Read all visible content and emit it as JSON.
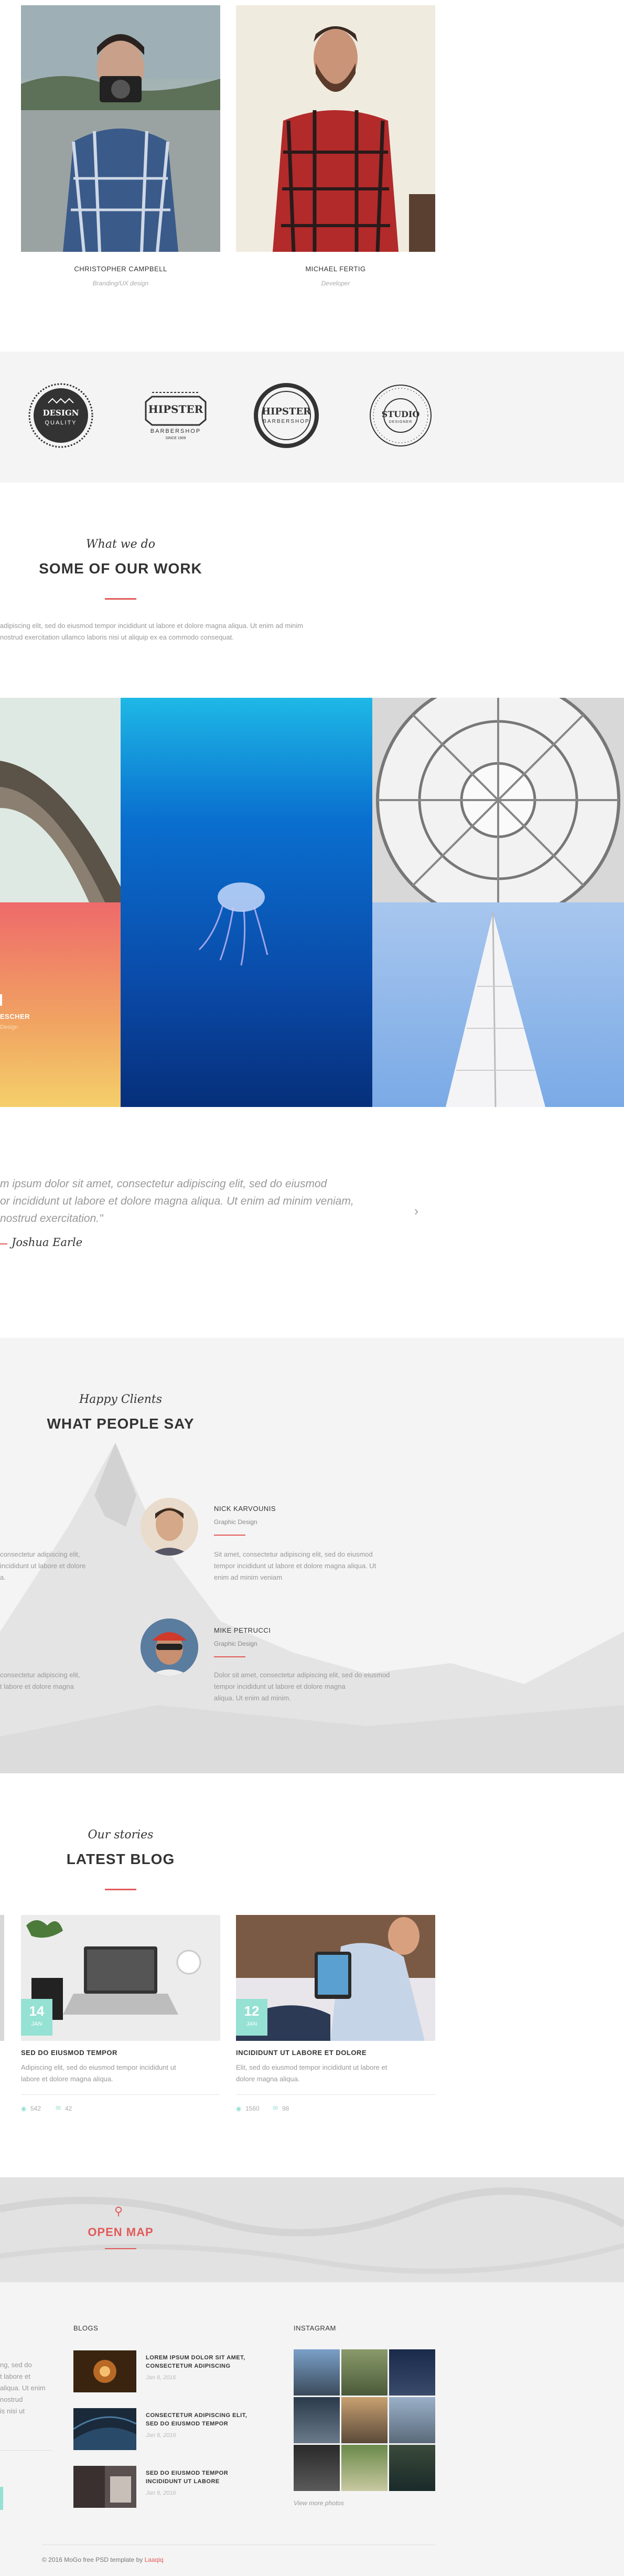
{
  "team": {
    "members": [
      {
        "name": "CHRISTOPHER CAMPBELL",
        "role": "Branding/UX design"
      },
      {
        "name": "MICHAEL FERTIG",
        "role": "Developer"
      }
    ]
  },
  "logos": [
    {
      "name": "design-quality-badge",
      "lines": [
        "DESIGN",
        "QUALITY"
      ]
    },
    {
      "name": "hipster-barbershop-badge",
      "lines": [
        "HIPSTER",
        "BARBERSHOP",
        "SINCE 1909"
      ]
    },
    {
      "name": "hipster-barbershop-round-badge",
      "lines": [
        "HIPSTER",
        "BARBERSHOP"
      ]
    },
    {
      "name": "studio-badge",
      "lines": [
        "STUDIO",
        "DESIGNER"
      ]
    }
  ],
  "work": {
    "script": "What we do",
    "title": "SOME OF OUR WORK",
    "text_line1": "adipiscing elit, sed do eiusmod tempor incididunt ut labore et dolore magna aliqua. Ut enim ad minim",
    "text_line2": "nostrud exercitation ullamco laboris nisi ut aliquip ex ea commodo consequat.",
    "overlay_title": "ESCHER",
    "overlay_sub": "Design"
  },
  "quote": {
    "line1": "m ipsum dolor sit amet, consectetur adipiscing elit, sed do eiusmod",
    "line2": "or incididunt ut labore et dolore magna aliqua. Ut enim ad minim veniam,",
    "line3": "nostrud exercitation.\"",
    "author": "Joshua Earle"
  },
  "testimonials": {
    "script": "Happy Clients",
    "title": "WHAT PEOPLE SAY",
    "left_partial_1": [
      "consectetur adipiscing elit,",
      "incididunt ut labore et dolore",
      "a."
    ],
    "left_partial_2": [
      "consectetur adipiscing elit,",
      "t labore et dolore magna"
    ],
    "items": [
      {
        "name": "NICK KARVOUNIS",
        "role": "Graphic Design",
        "text": [
          "Sit amet, consectetur adipiscing elit, sed do eiusmod",
          "tempor incididunt ut labore et dolore magna aliqua. Ut",
          "enim ad minim veniam"
        ]
      },
      {
        "name": "MIKE PETRUCCI",
        "role": "Graphic Design",
        "text": [
          "Dolor sit amet, consectetur adipiscing elit, sed do eiusmod",
          "tempor incididunt ut labore et dolore magna",
          "aliqua. Ut enim ad minim."
        ]
      }
    ]
  },
  "blog": {
    "script": "Our stories",
    "title": "LATEST BLOG",
    "posts": [
      {
        "day": "14",
        "month": "JAN",
        "title": "SED DO EIUSMOD TEMPOR",
        "text": [
          "Adipiscing elit, sed do eiusmod tempor incididunt ut",
          "labore et dolore magna aliqua."
        ],
        "views": "542",
        "comments": "42"
      },
      {
        "day": "12",
        "month": "JAN",
        "title": "INCIDIDUNT UT LABORE ET DOLORE",
        "text": [
          "Elit, sed do eiusmod tempor incididunt ut labore et",
          "dolore magna aliqua."
        ],
        "views": "1560",
        "comments": "98"
      }
    ]
  },
  "map": {
    "label": "OPEN MAP"
  },
  "footer": {
    "left_partial": [
      "ng, sed do",
      "t labore et",
      "aliqua. Ut enim",
      "nostrud",
      "is nisi ut"
    ],
    "blogs": {
      "title": "BLOGS",
      "items": [
        {
          "title": [
            "LOREM IPSUM DOLOR SIT AMET,",
            "CONSECTETUR ADIPISCING"
          ],
          "date": "Jan 9, 2016"
        },
        {
          "title": [
            "CONSECTETUR ADIPISCING ELIT,",
            "SED DO EIUSMOD TEMPOR"
          ],
          "date": "Jan 9, 2016"
        },
        {
          "title": [
            "SED DO EIUSMOD TEMPOR",
            "INCIDIDUNT UT LABORE"
          ],
          "date": "Jan 9, 2016"
        }
      ]
    },
    "instagram": {
      "title": "INSTAGRAM",
      "more": "View more photos"
    },
    "copyright_prefix": "© 2016 MoGo free PSD template by",
    "copyright_author": "Laaqiq"
  },
  "colors": {
    "accent": "#e25a5a",
    "teal": "#95e1d3"
  }
}
